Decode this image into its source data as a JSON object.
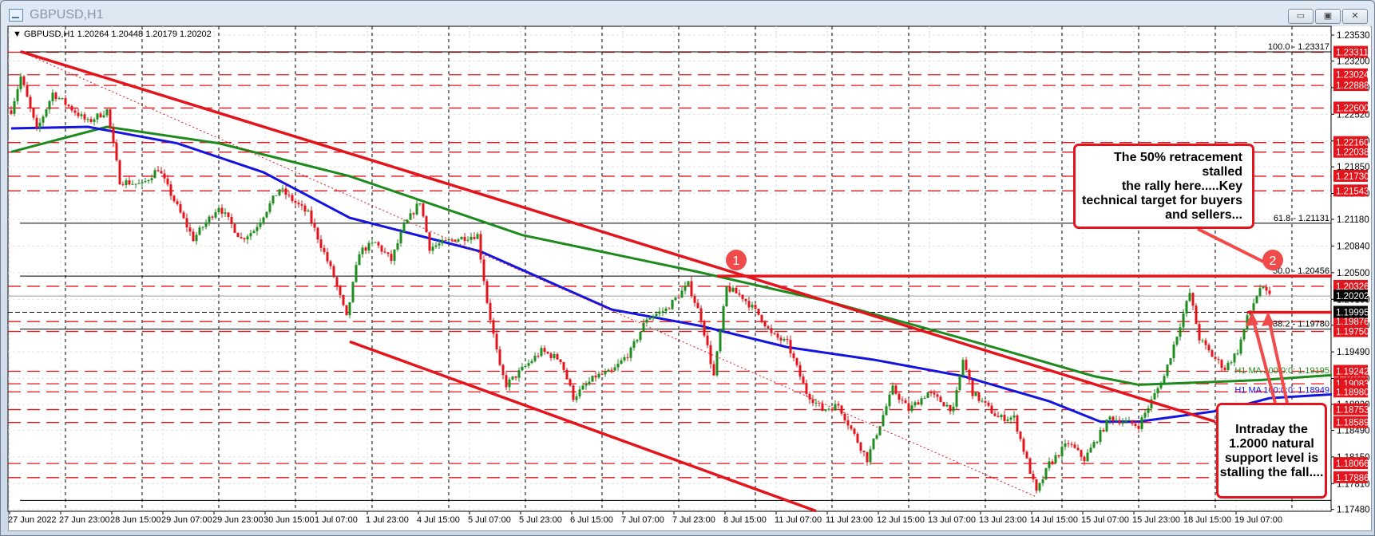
{
  "window": {
    "title": "GBPUSD,H1",
    "buttons": {
      "minimize": "▭",
      "restore": "▣",
      "close": "✕"
    }
  },
  "colors": {
    "bull": "#1e8c1e",
    "bear": "#e3141b",
    "level": "#e3141b",
    "ma200": "#1e8a1e",
    "ma100": "#1414e0",
    "fib": "#000000"
  },
  "chart_data": {
    "type": "candlestick",
    "header": "GBPUSD,H1  1.20264 1.20448 1.20179 1.20202",
    "ylim": [
      1.1748,
      1.2353
    ],
    "y_ticks": [
      "1.23530",
      "1.23200",
      "1.22860",
      "1.22520",
      "1.22180",
      "1.21850",
      "1.21510",
      "1.21180",
      "1.20840",
      "1.20500",
      "1.20160",
      "1.19830",
      "1.19490",
      "1.19150",
      "1.18820",
      "1.18490",
      "1.18150",
      "1.17810",
      "1.17480"
    ],
    "x_labels": [
      "27 Jun 2022",
      "27 Jun 23:00",
      "28 Jun 15:00",
      "29 Jun 07:00",
      "29 Jun 23:00",
      "30 Jun 15:00",
      "1 Jul 07:00",
      "1 Jul 23:00",
      "4 Jul 15:00",
      "5 Jul 07:00",
      "5 Jul 23:00",
      "6 Jul 15:00",
      "7 Jul 07:00",
      "7 Jul 23:00",
      "8 Jul 15:00",
      "11 Jul 07:00",
      "11 Jul 23:00",
      "12 Jul 15:00",
      "13 Jul 07:00",
      "13 Jul 23:00",
      "14 Jul 15:00",
      "15 Jul 07:00",
      "15 Jul 23:00",
      "18 Jul 15:00",
      "19 Jul 07:00"
    ],
    "bars_per_label": 16,
    "price_path": [
      [
        0,
        1.2257
      ],
      [
        3,
        1.23
      ],
      [
        8,
        1.2231
      ],
      [
        13,
        1.2279
      ],
      [
        24,
        1.2242
      ],
      [
        30,
        1.2257
      ],
      [
        34,
        1.2167
      ],
      [
        41,
        1.2162
      ],
      [
        46,
        1.2183
      ],
      [
        57,
        1.2093
      ],
      [
        65,
        1.2135
      ],
      [
        72,
        1.2093
      ],
      [
        76,
        1.2104
      ],
      [
        84,
        1.2157
      ],
      [
        93,
        1.2125
      ],
      [
        101,
        1.2045
      ],
      [
        105,
        1.1992
      ],
      [
        109,
        1.2077
      ],
      [
        114,
        1.2088
      ],
      [
        119,
        1.2066
      ],
      [
        123,
        1.2109
      ],
      [
        128,
        1.2141
      ],
      [
        131,
        1.2082
      ],
      [
        139,
        1.2093
      ],
      [
        146,
        1.2098
      ],
      [
        149,
        1.2013
      ],
      [
        153,
        1.1928
      ],
      [
        155,
        1.1907
      ],
      [
        166,
        1.195
      ],
      [
        172,
        1.1939
      ],
      [
        176,
        1.1891
      ],
      [
        183,
        1.1918
      ],
      [
        188,
        1.1923
      ],
      [
        194,
        1.195
      ],
      [
        199,
        1.1992
      ],
      [
        205,
        1.2003
      ],
      [
        212,
        1.2035
      ],
      [
        216,
        1.1992
      ],
      [
        220,
        1.1918
      ],
      [
        224,
        1.2031
      ],
      [
        229,
        1.2019
      ],
      [
        235,
        1.1992
      ],
      [
        238,
        1.1971
      ],
      [
        243,
        1.196
      ],
      [
        249,
        1.1897
      ],
      [
        254,
        1.1875
      ],
      [
        259,
        1.1881
      ],
      [
        268,
        1.1812
      ],
      [
        276,
        1.1902
      ],
      [
        281,
        1.1875
      ],
      [
        287,
        1.1897
      ],
      [
        295,
        1.1875
      ],
      [
        298,
        1.1939
      ],
      [
        301,
        1.1897
      ],
      [
        309,
        1.1865
      ],
      [
        314,
        1.1865
      ],
      [
        321,
        1.1769
      ],
      [
        325,
        1.1806
      ],
      [
        331,
        1.1833
      ],
      [
        336,
        1.1812
      ],
      [
        344,
        1.1865
      ],
      [
        353,
        1.1855
      ],
      [
        361,
        1.1918
      ],
      [
        365,
        1.1971
      ],
      [
        369,
        1.2024
      ],
      [
        372,
        1.1966
      ],
      [
        376,
        1.1944
      ],
      [
        380,
        1.1928
      ],
      [
        384,
        1.195
      ],
      [
        387,
        1.1992
      ],
      [
        391,
        1.2031
      ],
      [
        394,
        1.202
      ]
    ],
    "ma200": {
      "label": "H1 MA 200:0:0: 1.19195",
      "path": [
        [
          0,
          1.2204
        ],
        [
          30,
          1.2236
        ],
        [
          65,
          1.2215
        ],
        [
          106,
          1.2173
        ],
        [
          160,
          1.2098
        ],
        [
          215,
          1.2051
        ],
        [
          256,
          1.2013
        ],
        [
          298,
          1.1966
        ],
        [
          339,
          1.1918
        ],
        [
          353,
          1.1907
        ],
        [
          391,
          1.1913
        ],
        [
          414,
          1.19195
        ]
      ]
    },
    "ma100": {
      "label": "H1 MA 100:0:0: 1.18949",
      "path": [
        [
          0,
          1.2234
        ],
        [
          24,
          1.2236
        ],
        [
          52,
          1.2215
        ],
        [
          79,
          1.2178
        ],
        [
          106,
          1.212
        ],
        [
          147,
          1.2077
        ],
        [
          188,
          1.2003
        ],
        [
          216,
          1.1982
        ],
        [
          243,
          1.1955
        ],
        [
          270,
          1.1939
        ],
        [
          298,
          1.1918
        ],
        [
          325,
          1.1886
        ],
        [
          341,
          1.186
        ],
        [
          353,
          1.186
        ],
        [
          380,
          1.1875
        ],
        [
          394,
          1.189
        ],
        [
          414,
          1.18949
        ]
      ]
    },
    "levels": [
      "1.23311",
      "1.23024",
      "1.22888",
      "1.22600",
      "1.22160",
      "1.22038",
      "1.21730",
      "1.21543",
      "1.20326",
      "1.19876",
      "1.19750",
      "1.19242",
      "1.19083",
      "1.18980",
      "1.18753",
      "1.18589",
      "1.18066",
      "1.17886"
    ],
    "fibonacci": [
      {
        "label": "100.0 - 1.23317",
        "price": 1.23317
      },
      {
        "label": "61.8 - 1.21131",
        "price": 1.21131
      },
      {
        "label": "50.0 - 1.20456",
        "price": 1.20456
      },
      {
        "label": "38.2 - 1.19780",
        "price": 1.1978
      },
      {
        "label": "",
        "price": 1.17595
      }
    ],
    "current_price": {
      "label": "1.20202",
      "price": 1.20202
    },
    "key_level": {
      "label": "1.19995",
      "price": 1.19995
    },
    "trendlines": [
      {
        "style": "thick",
        "from": [
          3,
          1.2332
        ],
        "to": [
          377,
          1.186
        ]
      },
      {
        "style": "thick",
        "from": [
          106,
          1.1962
        ],
        "to": [
          252,
          1.1746
        ]
      },
      {
        "style": "dotted",
        "from": [
          3,
          1.2332
        ],
        "to": [
          321,
          1.1764
        ]
      },
      {
        "style": "thick",
        "from": [
          221,
          1.20456
        ],
        "to": [
          416,
          1.20456
        ]
      },
      {
        "style": "thick",
        "from": [
          387,
          1.19995
        ],
        "to": [
          416,
          1.19995
        ]
      }
    ],
    "markers": [
      {
        "label": "1",
        "bar": 227,
        "price": 1.2062
      },
      {
        "label": "2",
        "bar": 395,
        "price": 1.2062
      }
    ]
  },
  "annotations": {
    "note1": [
      "The 50% retracement stalled",
      "the rally here.....Key",
      "technical target for buyers",
      "and sellers..."
    ],
    "note2": [
      "Intraday the",
      "1.2000 natural",
      "support level is",
      "stalling the fall...."
    ]
  }
}
